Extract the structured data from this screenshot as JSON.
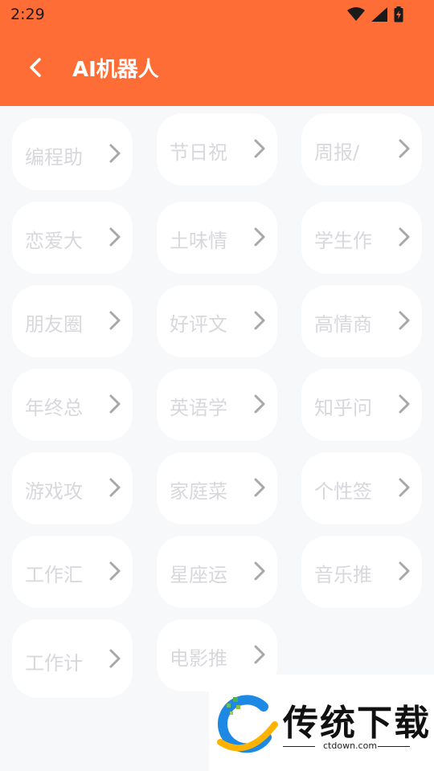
{
  "status_bar": {
    "time": "2:29"
  },
  "app_bar": {
    "title": "AI机器人"
  },
  "cards": [
    {
      "label": "编程助"
    },
    {
      "label": "节日祝"
    },
    {
      "label": "周报/"
    },
    {
      "label": "恋爱大"
    },
    {
      "label": "土味情"
    },
    {
      "label": "学生作"
    },
    {
      "label": "朋友圈"
    },
    {
      "label": "好评文"
    },
    {
      "label": "高情商"
    },
    {
      "label": "年终总"
    },
    {
      "label": "英语学"
    },
    {
      "label": "知乎问"
    },
    {
      "label": "游戏攻"
    },
    {
      "label": "家庭菜"
    },
    {
      "label": "个性签"
    },
    {
      "label": "工作汇"
    },
    {
      "label": "星座运"
    },
    {
      "label": "音乐推"
    },
    {
      "label": "工作计"
    },
    {
      "label": "电影推"
    }
  ],
  "promo": {
    "brand": "传统下载",
    "url": "ctdown.com"
  },
  "colors": {
    "accent": "#ff6d36",
    "card_text": "#d8d8dc",
    "chevron": "#a8a8aa"
  },
  "icons": {
    "back": "chevron-left-icon",
    "card": "chevron-right-icon"
  }
}
